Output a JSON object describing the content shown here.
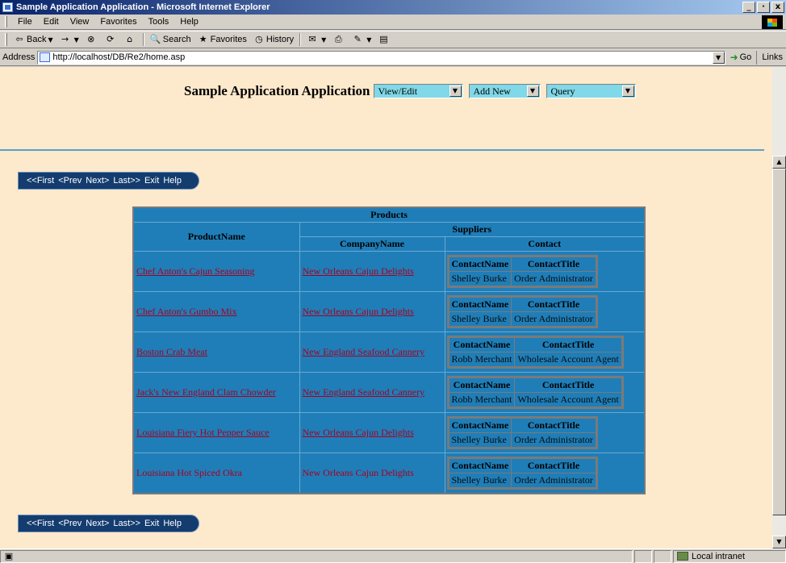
{
  "window": {
    "title": "Sample Application Application - Microsoft Internet Explorer",
    "controls": [
      "_",
      "·",
      "x"
    ]
  },
  "menu": [
    "File",
    "Edit",
    "View",
    "Favorites",
    "Tools",
    "Help"
  ],
  "toolbar": {
    "back": "Back",
    "search": "Search",
    "favorites": "Favorites",
    "history": "History"
  },
  "address": {
    "label": "Address",
    "url": "http://localhost/DB/Re2/home.asp",
    "go": "Go",
    "links": "Links"
  },
  "header": {
    "title": "Sample Application Application",
    "selects": [
      {
        "value": "View/Edit"
      },
      {
        "value": "Add New"
      },
      {
        "value": "Query"
      }
    ]
  },
  "nav": {
    "first": "<<First",
    "prev": "<Prev",
    "next": "Next>",
    "last": "Last>>",
    "exit": "Exit",
    "help": "Help"
  },
  "grid": {
    "title": "Products",
    "col_product": "ProductName",
    "group_suppliers": "Suppliers",
    "col_company": "CompanyName",
    "col_contact": "Contact",
    "contact_headers": [
      "ContactName",
      "ContactTitle"
    ],
    "rows": [
      {
        "product": "Chef Anton's Cajun Seasoning",
        "company": "New Orleans Cajun Delights",
        "contact_name": "Shelley Burke",
        "contact_title": "Order Administrator"
      },
      {
        "product": "Chef Anton's Gumbo Mix",
        "company": "New Orleans Cajun Delights",
        "contact_name": "Shelley Burke",
        "contact_title": "Order Administrator"
      },
      {
        "product": "Boston Crab Meat",
        "company": "New England Seafood Cannery",
        "contact_name": "Robb Merchant",
        "contact_title": "Wholesale Account Agent"
      },
      {
        "product": "Jack's New England Clam Chowder",
        "company": "New England Seafood Cannery",
        "contact_name": "Robb Merchant",
        "contact_title": "Wholesale Account Agent"
      },
      {
        "product": "Louisiana Fiery Hot Pepper Sauce",
        "company": "New Orleans Cajun Delights",
        "contact_name": "Shelley Burke",
        "contact_title": "Order Administrator"
      },
      {
        "product": "Louisiana Hot Spiced Okra",
        "company": "New Orleans Cajun Delights",
        "contact_name": "Shelley Burke",
        "contact_title": "Order Administrator"
      }
    ]
  },
  "status": {
    "text": "",
    "zone": "Local intranet"
  }
}
